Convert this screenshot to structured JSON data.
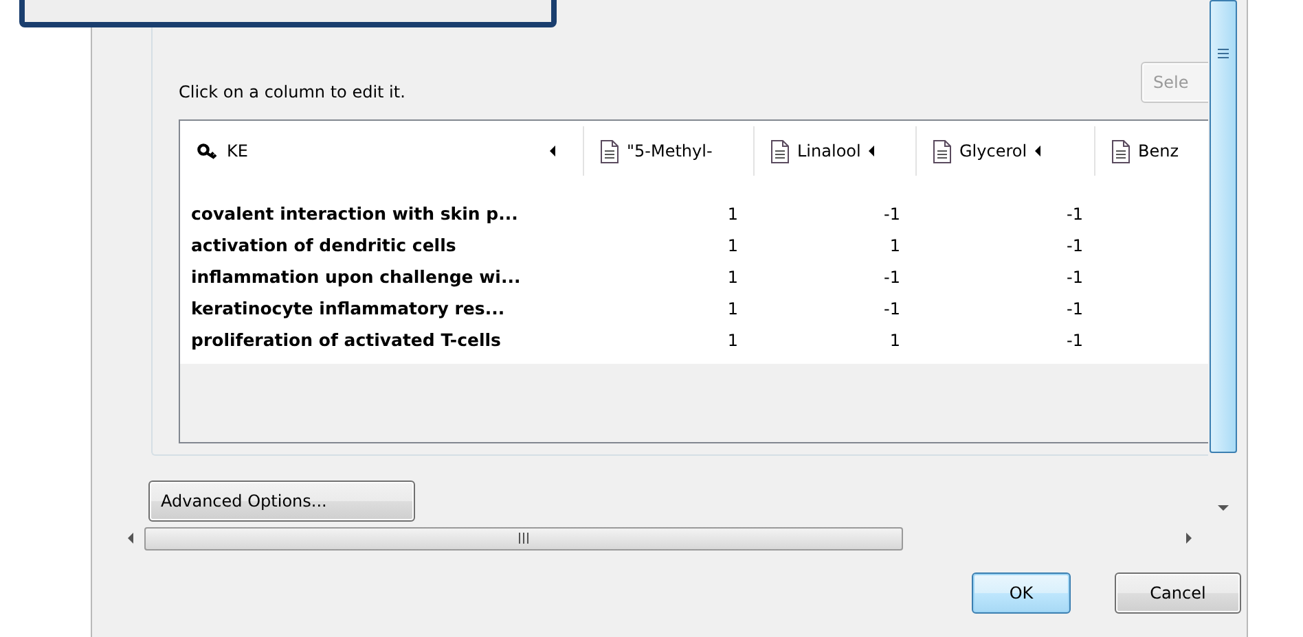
{
  "instruction": "Click on a column to edit it.",
  "select_button": "Sele",
  "table": {
    "columns": [
      {
        "label": "KE",
        "kind": "key",
        "arrow": true
      },
      {
        "label": "\"5-Methyl-",
        "kind": "document",
        "arrow": false
      },
      {
        "label": "Linalool",
        "kind": "document",
        "arrow": true
      },
      {
        "label": "Glycerol",
        "kind": "document",
        "arrow": true
      },
      {
        "label": "Benz",
        "kind": "document",
        "arrow": false
      }
    ],
    "rows": [
      {
        "cells": [
          "covalent interaction with skin p...",
          "1",
          "-1",
          "-1"
        ]
      },
      {
        "cells": [
          "activation of dendritic cells",
          "1",
          "1",
          "-1"
        ]
      },
      {
        "cells": [
          "inflammation upon challenge wi...",
          "1",
          "-1",
          "-1"
        ]
      },
      {
        "cells": [
          "keratinocyte inflammatory res...",
          "1",
          "-1",
          "-1"
        ]
      },
      {
        "cells": [
          "proliferation of activated T-cells",
          "1",
          "1",
          "-1"
        ]
      }
    ]
  },
  "advanced_button": "Advanced Options...",
  "buttons": [
    {
      "label": "OK",
      "default": true
    },
    {
      "label": "Cancel",
      "default": false
    }
  ]
}
